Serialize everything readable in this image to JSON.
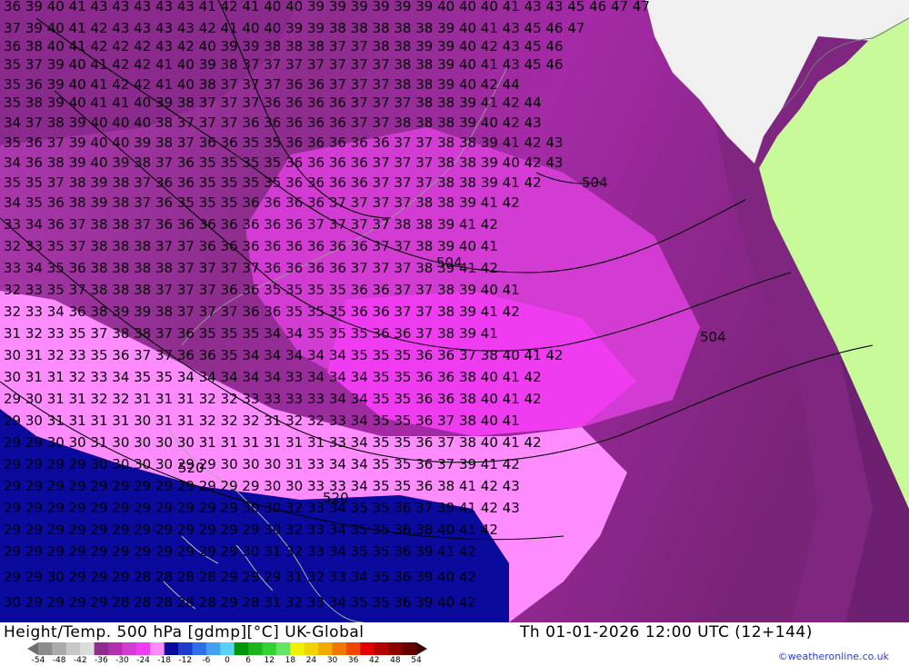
{
  "title": "Height/Temp. 500 hPa [gdmp][°C] UK-Global",
  "valid_time": "Th 01-01-2026 12:00 UTC (12+144)",
  "credit": "©weatheronline.co.uk",
  "legend": {
    "ticks": [
      "-54",
      "-48",
      "-42",
      "-36",
      "-30",
      "-24",
      "-18",
      "-12",
      "-6",
      "0",
      "6",
      "12",
      "18",
      "24",
      "30",
      "36",
      "42",
      "48",
      "54"
    ],
    "colors": [
      "#6e6e6e",
      "#8c8c8c",
      "#aaaaaa",
      "#c8c8c8",
      "#dcdcdc",
      "#8e2d8e",
      "#b030b0",
      "#d23cd2",
      "#f03cf0",
      "#ff8cff",
      "#0a0a9c",
      "#1e3ccc",
      "#2e6ee6",
      "#44a0f0",
      "#5ad2f5",
      "#009600",
      "#1eb41e",
      "#32d232",
      "#64e664",
      "#f0f000",
      "#f0d200",
      "#f0aa00",
      "#f07800",
      "#f04600",
      "#e00000",
      "#b40000",
      "#8c0000",
      "#640000",
      "#3c0000"
    ]
  },
  "labels": {
    "rows": [
      {
        "text": "36 39 40 41 43 43 43 43 43 41 42 41 40 40 39 39 39 39 39 39 40 40 40 41 43 43 45 46 47 47"
      },
      {
        "text": "37 39 40 41 42 43 43 43 43 42 41 40 40 39 39 38 38 38 38 38 39 40 41 43 45 46 47"
      },
      {
        "text": "36 38 40 41 42 42 42 43 42 40 39 39 38 38 38 37 37 38 38 39 39 40 42 43 45 46"
      },
      {
        "text": "35 37 39 40 41 42 42 41 40 39 38 37 37 37 37 37 37 37 38 38 39 40 41 43 45 46"
      },
      {
        "text": "35 36 39 40 41 42 42 41 40 38 37 37 37 36 36 37 37 37 38 38 39 40 42 44"
      },
      {
        "text": "35 38 39 40 41 41 40 39 38 37 37 37 36 36 36 36 37 37 37 38 38 39 41 42 44"
      },
      {
        "text": "34 37 38 39 40 40 40 38 37 37 37 36 36 36 36 36 37 37 38 38 38 39 40 42 43"
      },
      {
        "text": "35 36 37 39 40 40 39 38 37 36 36 35 35 36 36 36 36 36 37 37 38 38 39 41 42 43"
      },
      {
        "text": "34 36 38 39 40 39 38 37 36 35 35 35 35 36 36 36 36 37 37 37 38 38 39 40 42 43"
      },
      {
        "text": "35 35 37 38 39 38 37 36 36 35 35 35 35 36 36 36 36 37 37 37 38 38 39 41 42"
      },
      {
        "text": "34 35 36 38 39 38 37 36 35 35 35 36 36 36 36 37 37 37 37 38 38 39 41 42"
      },
      {
        "text": "33 34 36 37 38 38 37 36 36 36 36 36 36 36 37 37 37 37 38 38 39 41 42"
      },
      {
        "text": "32 33 35 37 38 38 38 37 37 36 36 36 36 36 36 36 36 37 37 38 39 40 41"
      },
      {
        "text": "33 34 35 36 38 38 38 38 37 37 37 37 36 36 36 36 37 37 37 38 39 41 42"
      },
      {
        "text": "32 33 35 37 38 38 38 37 37 37 36 36 35 35 35 35 36 36 37 37 38 39 40 41"
      },
      {
        "text": "32 33 34 36 38 39 39 38 37 37 37 36 36 35 35 35 36 36 37 37 38 39 41 42"
      },
      {
        "text": "31 32 33 35 37 38 38 37 36 35 35 35 34 34 35 35 35 36 36 37 38 39 41"
      },
      {
        "text": "30 31 32 33 35 36 37 37 36 36 35 34 34 34 34 34 35 35 35 36 36 37 38 40 41 42"
      },
      {
        "text": "30 31 31 32 33 34 35 35 34 34 34 34 34 33 34 34 34 35 35 36 36 38 40 41 42"
      },
      {
        "text": "29 30 31 31 32 32 31 31 31 32 32 33 33 33 33 34 34 35 35 36 36 38 40 41 42"
      },
      {
        "text": "29 30 31 31 31 31 30 31 31 32 32 32 31 32 32 33 34 35 35 36 37 38 40 41"
      },
      {
        "text": "29 29 30 30 31 30 30 30 30 31 31 31 31 31 31 33 34 35 35 36 37 38 40 41 42"
      },
      {
        "text": "29 29 29 29 30 30 30 30 29 29 30 30 30 31 33 34 34 35 35 36 37 39 41 42"
      },
      {
        "text": "29 29 29 29 29 29 29 29 29 29 29 29 30 30 33 33 34 35 35 36 38 41 42 43"
      },
      {
        "text": "29 29 29 29 29 29 29 29 29 29 29 30 30 32 33 34 35 35 36 37 39 41 42 43"
      },
      {
        "text": "29 29 29 29 29 29 29 29 29 29 29 29 30 32 33 34 35 35 36 38 40 41 42"
      },
      {
        "text": "29 29 29 29 29 29 29 29 29 29 29 30 31 32 33 34 35 35 36 39 41 42"
      },
      {
        "text": "29 29 30 29 29 29 28 28 28 28 29 29 29 31 32 33 34 35 36 39 40 42"
      },
      {
        "text": "30 29 29 29 29 28 28 28 28 28 29 28 31 32 33 34 35 35 36 39 40 42"
      }
    ],
    "contours": [
      {
        "text": "504"
      },
      {
        "text": "504"
      },
      {
        "text": "504"
      },
      {
        "text": "520"
      },
      {
        "text": "520"
      }
    ]
  }
}
